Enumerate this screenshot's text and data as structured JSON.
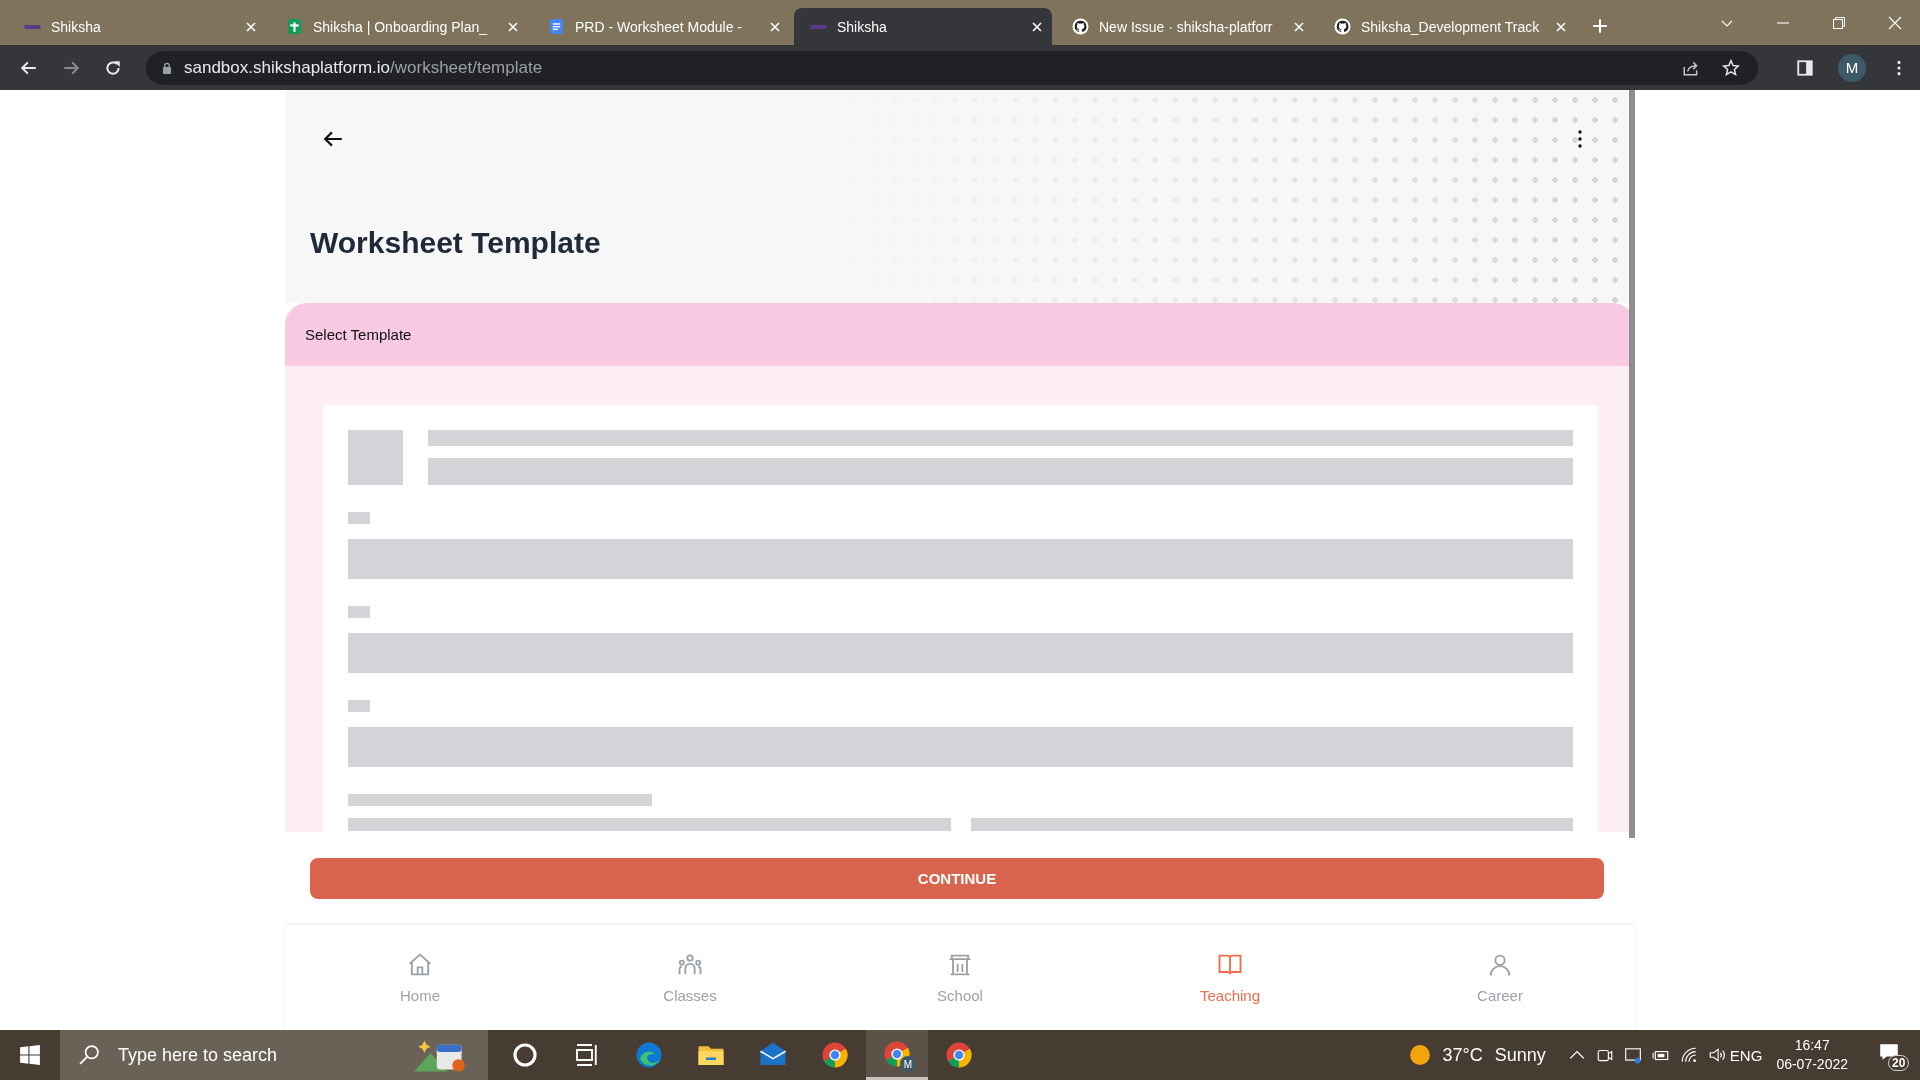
{
  "browser": {
    "tabs": [
      {
        "title": "Shiksha",
        "kind": "shiksha",
        "selected": false
      },
      {
        "title": "Shiksha | Onboarding Plan_",
        "kind": "sheets",
        "selected": false
      },
      {
        "title": "PRD - Worksheet Module -",
        "kind": "docs",
        "selected": false
      },
      {
        "title": "Shiksha",
        "kind": "shiksha",
        "selected": true
      },
      {
        "title": "New Issue · shiksha-platforr",
        "kind": "github",
        "selected": false
      },
      {
        "title": "Shiksha_Development Track",
        "kind": "github",
        "selected": false
      }
    ],
    "url": {
      "host": "sandbox.shikshaplatform.io",
      "path": "/worksheet/template"
    },
    "profile": "M"
  },
  "page": {
    "title": "Worksheet Template",
    "section": "Select Template",
    "button": "CONTINUE",
    "nav": [
      {
        "label": "Home",
        "kind": "home",
        "selected": false
      },
      {
        "label": "Classes",
        "kind": "classes",
        "selected": false
      },
      {
        "label": "School",
        "kind": "school",
        "selected": false
      },
      {
        "label": "Teaching",
        "kind": "book",
        "selected": true
      },
      {
        "label": "Career",
        "kind": "person",
        "selected": false
      }
    ]
  },
  "taskbar": {
    "search": {
      "placeholder": "Type here to search"
    },
    "apps": [
      {
        "kind": "cortana"
      },
      {
        "kind": "taskview"
      },
      {
        "kind": "edge"
      },
      {
        "kind": "explorer"
      },
      {
        "kind": "mail"
      },
      {
        "kind": "chrome",
        "active": false
      },
      {
        "kind": "chrome",
        "active": true,
        "badge": "M"
      },
      {
        "kind": "chrome",
        "active": false
      }
    ],
    "temperature": "37°C",
    "weather": "Sunny",
    "language": "ENG",
    "time": "16:47",
    "date": "06-07-2022",
    "notifications": "20"
  }
}
